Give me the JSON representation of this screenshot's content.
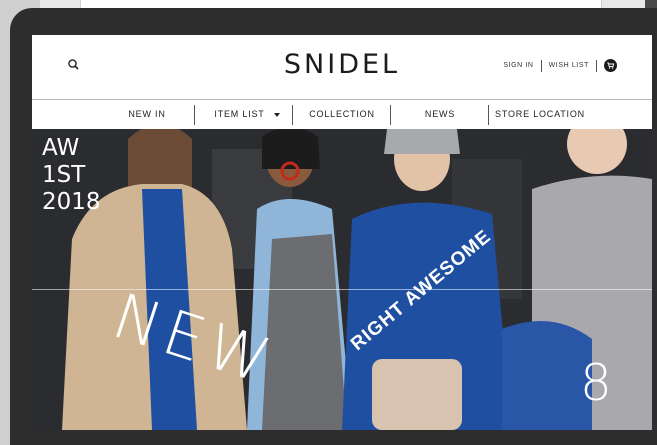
{
  "header": {
    "logo": "SNIDEL",
    "sign_in": "SIGN IN",
    "wish_list": "WISH LIST"
  },
  "nav": {
    "items": [
      "NEW IN",
      "ITEM LIST",
      "COLLECTION",
      "NEWS",
      "STORE LOCATION"
    ]
  },
  "hero": {
    "title_lines": [
      "AW",
      "1ST",
      "2018"
    ],
    "overlay_text": "NEW",
    "sweatshirt_text": "RIGHT AWESOME",
    "digit": "8"
  },
  "icons": {
    "search": "search-icon",
    "cart": "cart-icon",
    "dropdown": "caret-down-icon"
  },
  "colors": {
    "text": "#1b1b1b",
    "device": "#2d2d2d",
    "sweatshirt_blue": "#1f4fa0"
  }
}
